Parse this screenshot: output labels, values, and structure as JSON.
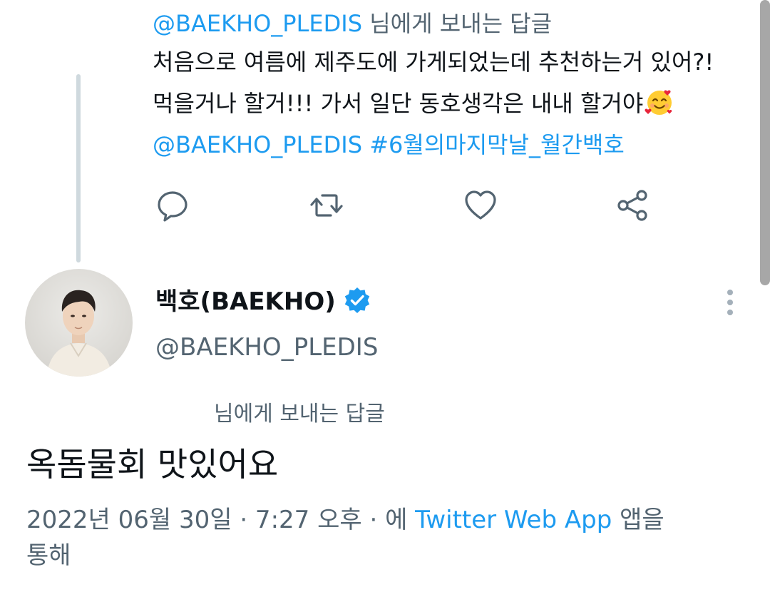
{
  "parent_tweet": {
    "reply_prefix_handle": "@BAEKHO_PLEDIS",
    "reply_prefix_suffix": "님에게 보내는 답글",
    "line1": "처음으로 여름에 제주도에 가게되었는데 추천하는거 있어?!",
    "line2": "먹을거나 할거!!! 가서 일단 동호생각은 내내 할거야",
    "line2_emoji": "smiling-face-with-hearts-icon",
    "mention": "@BAEKHO_PLEDIS",
    "hashtag": "#6월의마지막날_월간백호",
    "actions": [
      "reply-icon",
      "retweet-icon",
      "like-icon",
      "share-icon"
    ]
  },
  "main_tweet": {
    "author_name": "백호(BAEKHO)",
    "author_handle": "@BAEKHO_PLEDIS",
    "verified": true,
    "reply_to": "님에게 보내는 답글",
    "text": "옥돔물회 맛있어요",
    "timestamp": "2022년 06월 30일 · 7:27 오후 · 에",
    "source_app": "Twitter Web App",
    "source_suffix": "앱을",
    "source_suffix_line2": "통해"
  },
  "colors": {
    "link": "#1d9bf0",
    "muted": "#536471",
    "text": "#0f1419",
    "thread_line": "#cfd9de"
  }
}
